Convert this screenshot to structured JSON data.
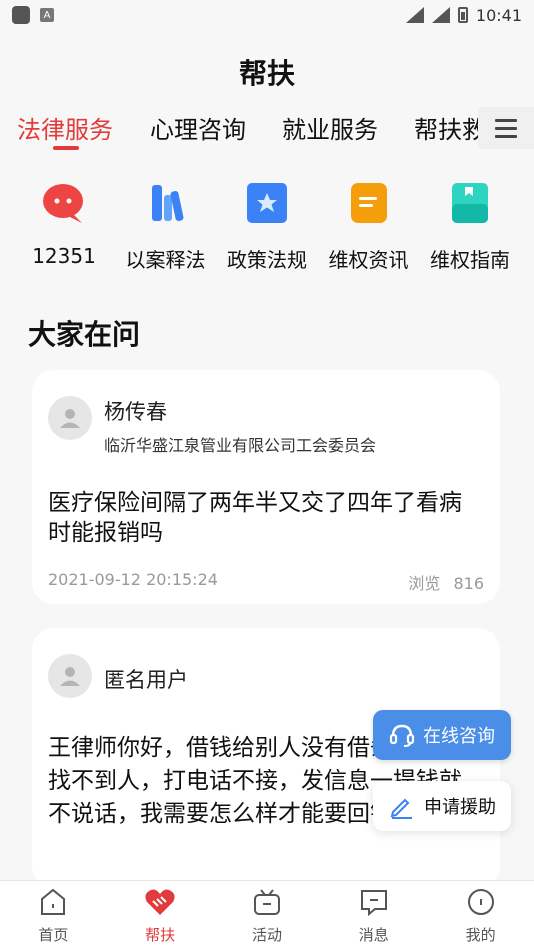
{
  "status_bar": {
    "time": "10:41",
    "indicator_a": "A"
  },
  "header": {
    "title": "帮扶"
  },
  "tabs": [
    {
      "label": "法律服务",
      "active": true
    },
    {
      "label": "心理咨询"
    },
    {
      "label": "就业服务"
    },
    {
      "label": "帮扶救"
    }
  ],
  "services": [
    {
      "label": "12351",
      "icon": "chat-bubble-icon",
      "color": "#ef4444"
    },
    {
      "label": "以案释法",
      "icon": "book-icon",
      "color": "#3b82f6"
    },
    {
      "label": "政策法规",
      "icon": "star-doc-icon",
      "color": "#3b82f6"
    },
    {
      "label": "维权资讯",
      "icon": "note-icon",
      "color": "#f59e0b"
    },
    {
      "label": "维权指南",
      "icon": "guide-icon",
      "color": "#22c1c3"
    }
  ],
  "section": {
    "title": "大家在问"
  },
  "questions": [
    {
      "user": "杨传春",
      "org": "临沂华盛江泉管业有限公司工会委员会",
      "text": "医疗保险间隔了两年半又交了四年了看病时能报销吗",
      "date": "2021-09-12 20:15:24",
      "views_label": "浏览",
      "views": "816"
    },
    {
      "user": "匿名用户",
      "text": "王律师你好，借钱给别人没有借条，现在找不到人，打电话不接，发信息一提钱就不说话，我需要怎么样才能要回钱。"
    }
  ],
  "float_buttons": {
    "consult": "在线咨询",
    "help": "申请援助"
  },
  "bottom_nav": [
    {
      "label": "首页",
      "icon": "home-icon"
    },
    {
      "label": "帮扶",
      "icon": "handshake-icon",
      "active": true
    },
    {
      "label": "活动",
      "icon": "gift-icon"
    },
    {
      "label": "消息",
      "icon": "message-icon"
    },
    {
      "label": "我的",
      "icon": "profile-icon"
    }
  ],
  "colors": {
    "accent": "#e23b3b",
    "consult_button": "#4a8ee8"
  }
}
